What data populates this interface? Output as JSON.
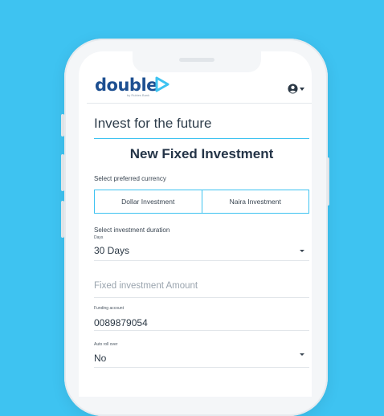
{
  "brand": {
    "name": "double",
    "tagline": "by Rubies Bank"
  },
  "header": {
    "user_menu": "user-account"
  },
  "page": {
    "title": "Invest for the future"
  },
  "form": {
    "title": "New Fixed Investment",
    "currency": {
      "label": "Select preferred currency",
      "options": [
        "Dollar Investment",
        "Naira Investment"
      ]
    },
    "duration": {
      "label": "Select investment duration",
      "unit_label": "Days",
      "value": "30 Days"
    },
    "amount": {
      "placeholder": "Fixed investment Amount"
    },
    "funding": {
      "label": "Funding account",
      "value": "0089879054"
    },
    "rollover": {
      "label": "Auto roll over",
      "value": "No"
    }
  },
  "colors": {
    "background": "#3ec3f1",
    "accent": "#3ec3f1",
    "brand": "#1d4f91"
  }
}
